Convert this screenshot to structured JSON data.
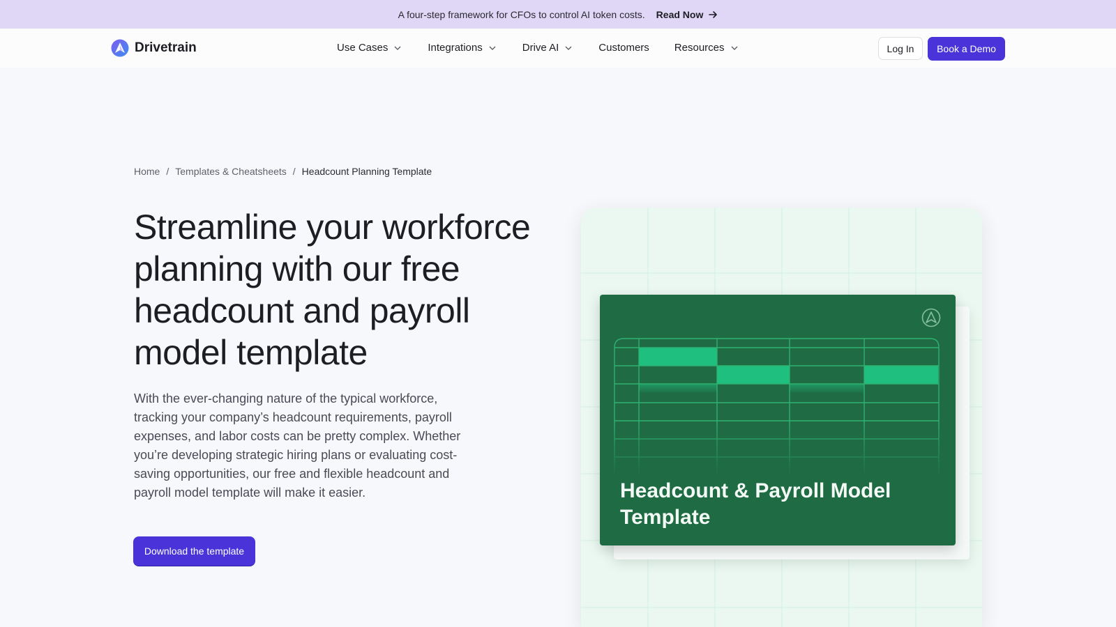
{
  "announcement": {
    "text": "A four-step framework for CFOs to control AI token costs.",
    "link_label": "Read Now"
  },
  "nav": {
    "brand": "Drivetrain",
    "menu": [
      {
        "label": "Use Cases",
        "has_dropdown": true
      },
      {
        "label": "Integrations",
        "has_dropdown": true
      },
      {
        "label": "Drive AI",
        "has_dropdown": true
      },
      {
        "label": "Customers",
        "has_dropdown": false
      },
      {
        "label": "Resources",
        "has_dropdown": true
      }
    ],
    "login_label": "Log In",
    "demo_label": "Book a Demo"
  },
  "breadcrumb": {
    "items": [
      "Home",
      "Templates & Cheatsheets",
      "Headcount Planning Template"
    ],
    "separator": "/"
  },
  "hero": {
    "title": "Streamline your workforce planning with our free headcount and payroll model template",
    "description": "With the ever-changing nature of the typical workforce, tracking your company’s headcount requirements, payroll expenses, and labor costs can be pretty complex. Whether you’re developing strategic hiring plans or evaluating cost-saving opportunities, our free and flexible headcount and payroll model template will make it easier.",
    "cta_label": "Download the template"
  },
  "preview": {
    "title": "Headcount & Payroll Model Template",
    "icon": "drivetrain-logo-icon"
  },
  "colors": {
    "announcement_bg": "#e0d7f6",
    "accent": "#4a34d9",
    "sheet_green": "#1f6b44",
    "highlight_green": "#1fbf7f",
    "card_bg": "#eaf8f1"
  }
}
